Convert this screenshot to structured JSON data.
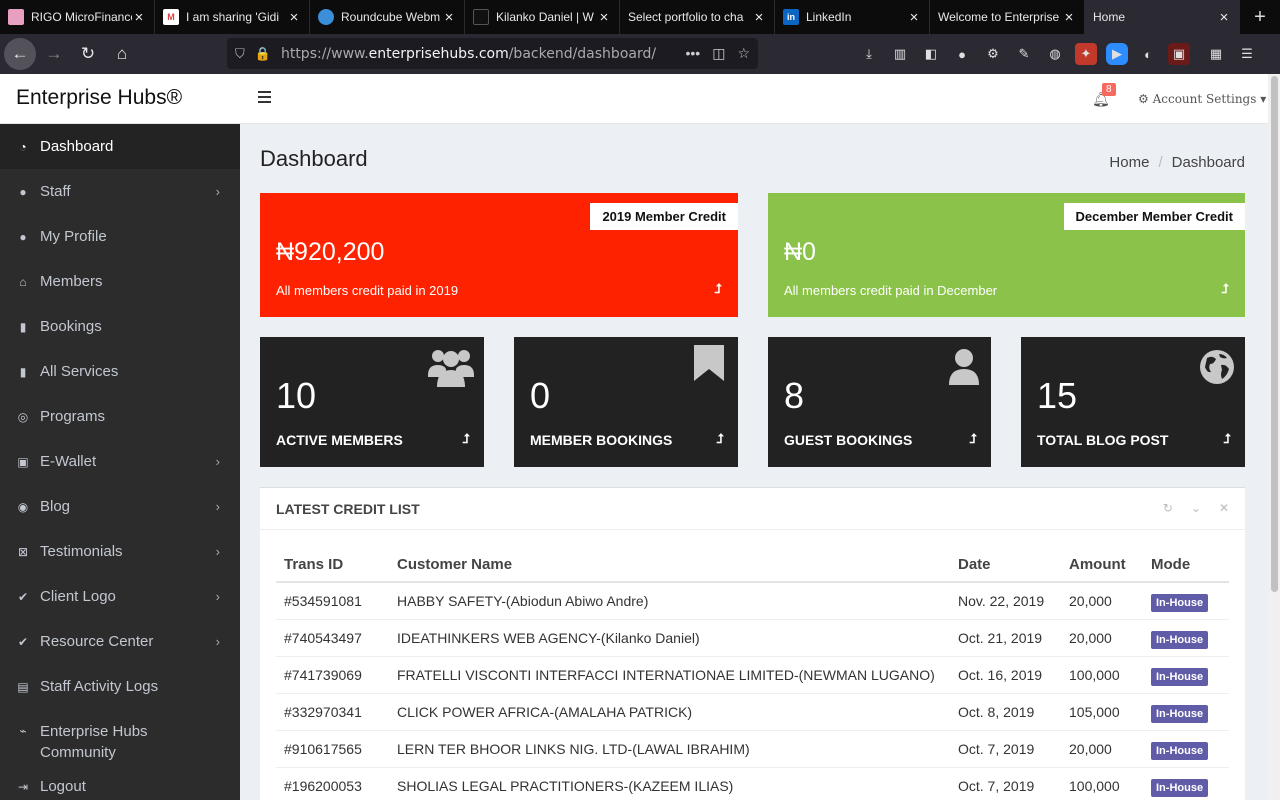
{
  "browser": {
    "tabs": [
      {
        "title": "RIGO MicroFinance",
        "active": false
      },
      {
        "title": "I am sharing 'Gidi",
        "active": false
      },
      {
        "title": "Roundcube Webm",
        "active": false
      },
      {
        "title": "Kilanko Daniel | W",
        "active": false
      },
      {
        "title": "Select portfolio to cha",
        "active": false
      },
      {
        "title": "LinkedIn",
        "active": false
      },
      {
        "title": "Welcome to Enterprise",
        "active": false
      },
      {
        "title": "Home",
        "active": true
      }
    ],
    "url_prefix": "https://www.",
    "url_host": "enterprisehubs.com",
    "url_path": "/backend/dashboard/"
  },
  "header": {
    "brand": "Enterprise Hubs®",
    "notification_count": "8",
    "account_label": "Account Settings"
  },
  "sidebar": {
    "items": [
      {
        "label": "Dashboard",
        "icon": "dashboard-icon"
      },
      {
        "label": "Staff",
        "icon": "users-icon"
      },
      {
        "label": "My Profile",
        "icon": "user-icon"
      },
      {
        "label": "Members",
        "icon": "home-icon"
      },
      {
        "label": "Bookings",
        "icon": "bookmark-icon"
      },
      {
        "label": "All Services",
        "icon": "bookmark-icon"
      },
      {
        "label": "Programs",
        "icon": "life-ring-icon"
      },
      {
        "label": "E-Wallet",
        "icon": "money-icon"
      },
      {
        "label": "Blog",
        "icon": "globe-icon"
      },
      {
        "label": "Testimonials",
        "icon": "close-box-icon"
      },
      {
        "label": "Client Logo",
        "icon": "check-icon"
      },
      {
        "label": "Resource Center",
        "icon": "check-icon"
      },
      {
        "label": "Staff Activity Logs",
        "icon": "archive-icon"
      },
      {
        "label": "Enterprise Hubs Community",
        "icon": "rss-icon"
      },
      {
        "label": "Logout",
        "icon": "logout-icon"
      }
    ]
  },
  "main": {
    "title": "Dashboard",
    "breadcrumb": [
      "Home",
      "Dashboard"
    ],
    "credit_boxes": [
      {
        "tag": "2019 Member Credit",
        "amount": "₦920,200",
        "desc": "All members credit paid in 2019",
        "color": "#ff2200"
      },
      {
        "tag": "December Member Credit",
        "amount": "₦0",
        "desc": "All members credit paid in December",
        "color": "#8bc34a"
      }
    ],
    "stats": [
      {
        "value": "10",
        "label": "ACTIVE MEMBERS",
        "icon": "users-icon"
      },
      {
        "value": "0",
        "label": "MEMBER BOOKINGS",
        "icon": "bookmark-icon"
      },
      {
        "value": "8",
        "label": "GUEST BOOKINGS",
        "icon": "user-icon"
      },
      {
        "value": "15",
        "label": "TOTAL BLOG POST",
        "icon": "globe-icon"
      }
    ],
    "credit_list": {
      "title": "LATEST CREDIT LIST",
      "columns": [
        "Trans ID",
        "Customer Name",
        "Date",
        "Amount",
        "Mode"
      ],
      "rows": [
        [
          "#534591081",
          "HABBY SAFETY-(Abiodun Abiwo Andre)",
          "Nov. 22, 2019",
          "20,000",
          "In-House"
        ],
        [
          "#740543497",
          "IDEATHINKERS WEB AGENCY-(Kilanko Daniel)",
          "Oct. 21, 2019",
          "20,000",
          "In-House"
        ],
        [
          "#741739069",
          "FRATELLI VISCONTI INTERFACCI INTERNATIONAE LIMITED-(NEWMAN LUGANO)",
          "Oct. 16, 2019",
          "100,000",
          "In-House"
        ],
        [
          "#332970341",
          "CLICK POWER AFRICA-(AMALAHA PATRICK)",
          "Oct. 8, 2019",
          "105,000",
          "In-House"
        ],
        [
          "#910617565",
          "LERN TER BHOOR LINKS NIG. LTD-(LAWAL IBRAHIM)",
          "Oct. 7, 2019",
          "20,000",
          "In-House"
        ],
        [
          "#196200053",
          "SHOLIAS LEGAL PRACTITIONERS-(KAZEEM ILIAS)",
          "Oct. 7, 2019",
          "100,000",
          "In-House"
        ]
      ]
    }
  }
}
